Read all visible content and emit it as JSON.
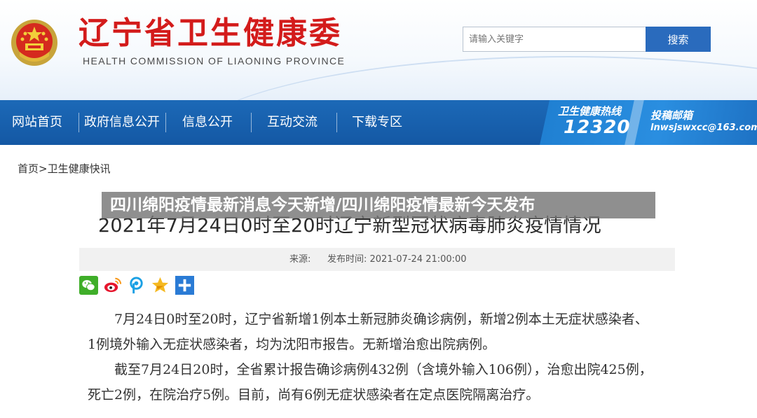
{
  "header": {
    "title_cn": "辽宁省卫生健康委",
    "title_en": "HEALTH COMMISSION OF LIAONING PROVINCE"
  },
  "search": {
    "placeholder": "请输入关键字",
    "button_label": "搜索"
  },
  "nav": {
    "items": [
      "网站首页",
      "政府信息公开",
      "信息公开",
      "互动交流",
      "下载专区"
    ],
    "hotline_label": "卫生健康热线",
    "hotline_number": "12320",
    "contribute_label": "投稿邮箱",
    "contribute_email": "lnwsjswxcc@163.com"
  },
  "breadcrumb": {
    "home": "首页",
    "separator": ">",
    "current": "卫生健康快讯"
  },
  "overlay_title": "四川绵阳疫情最新消息今天新增/四川绵阳疫情最新今天发布",
  "article": {
    "title": "2021年7月24日0时至20时辽宁新型冠状病毒肺炎疫情情况",
    "source_label": "来源:",
    "publish_time": "发布时间: 2021-07-24 21:00:00",
    "paragraphs": [
      "7月24日0时至20时，辽宁省新增1例本土新冠肺炎确诊病例，新增2例本土无症状感染者、1例境外输入无症状感染者，均为沈阳市报告。无新增治愈出院病例。",
      "截至7月24日20时，全省累计报告确诊病例432例（含境外输入106例），治愈出院425例，死亡2例，在院治疗5例。目前，尚有6例无症状感染者在定点医院隔离治疗。"
    ]
  },
  "share_icons": [
    "wechat-icon",
    "weibo-icon",
    "pengyou-icon",
    "qzone-star-icon",
    "more-plus-icon"
  ],
  "colors": {
    "title_red": "#d31b1b",
    "nav_blue": "#1a64b3",
    "search_blue": "#2a6bbd"
  }
}
